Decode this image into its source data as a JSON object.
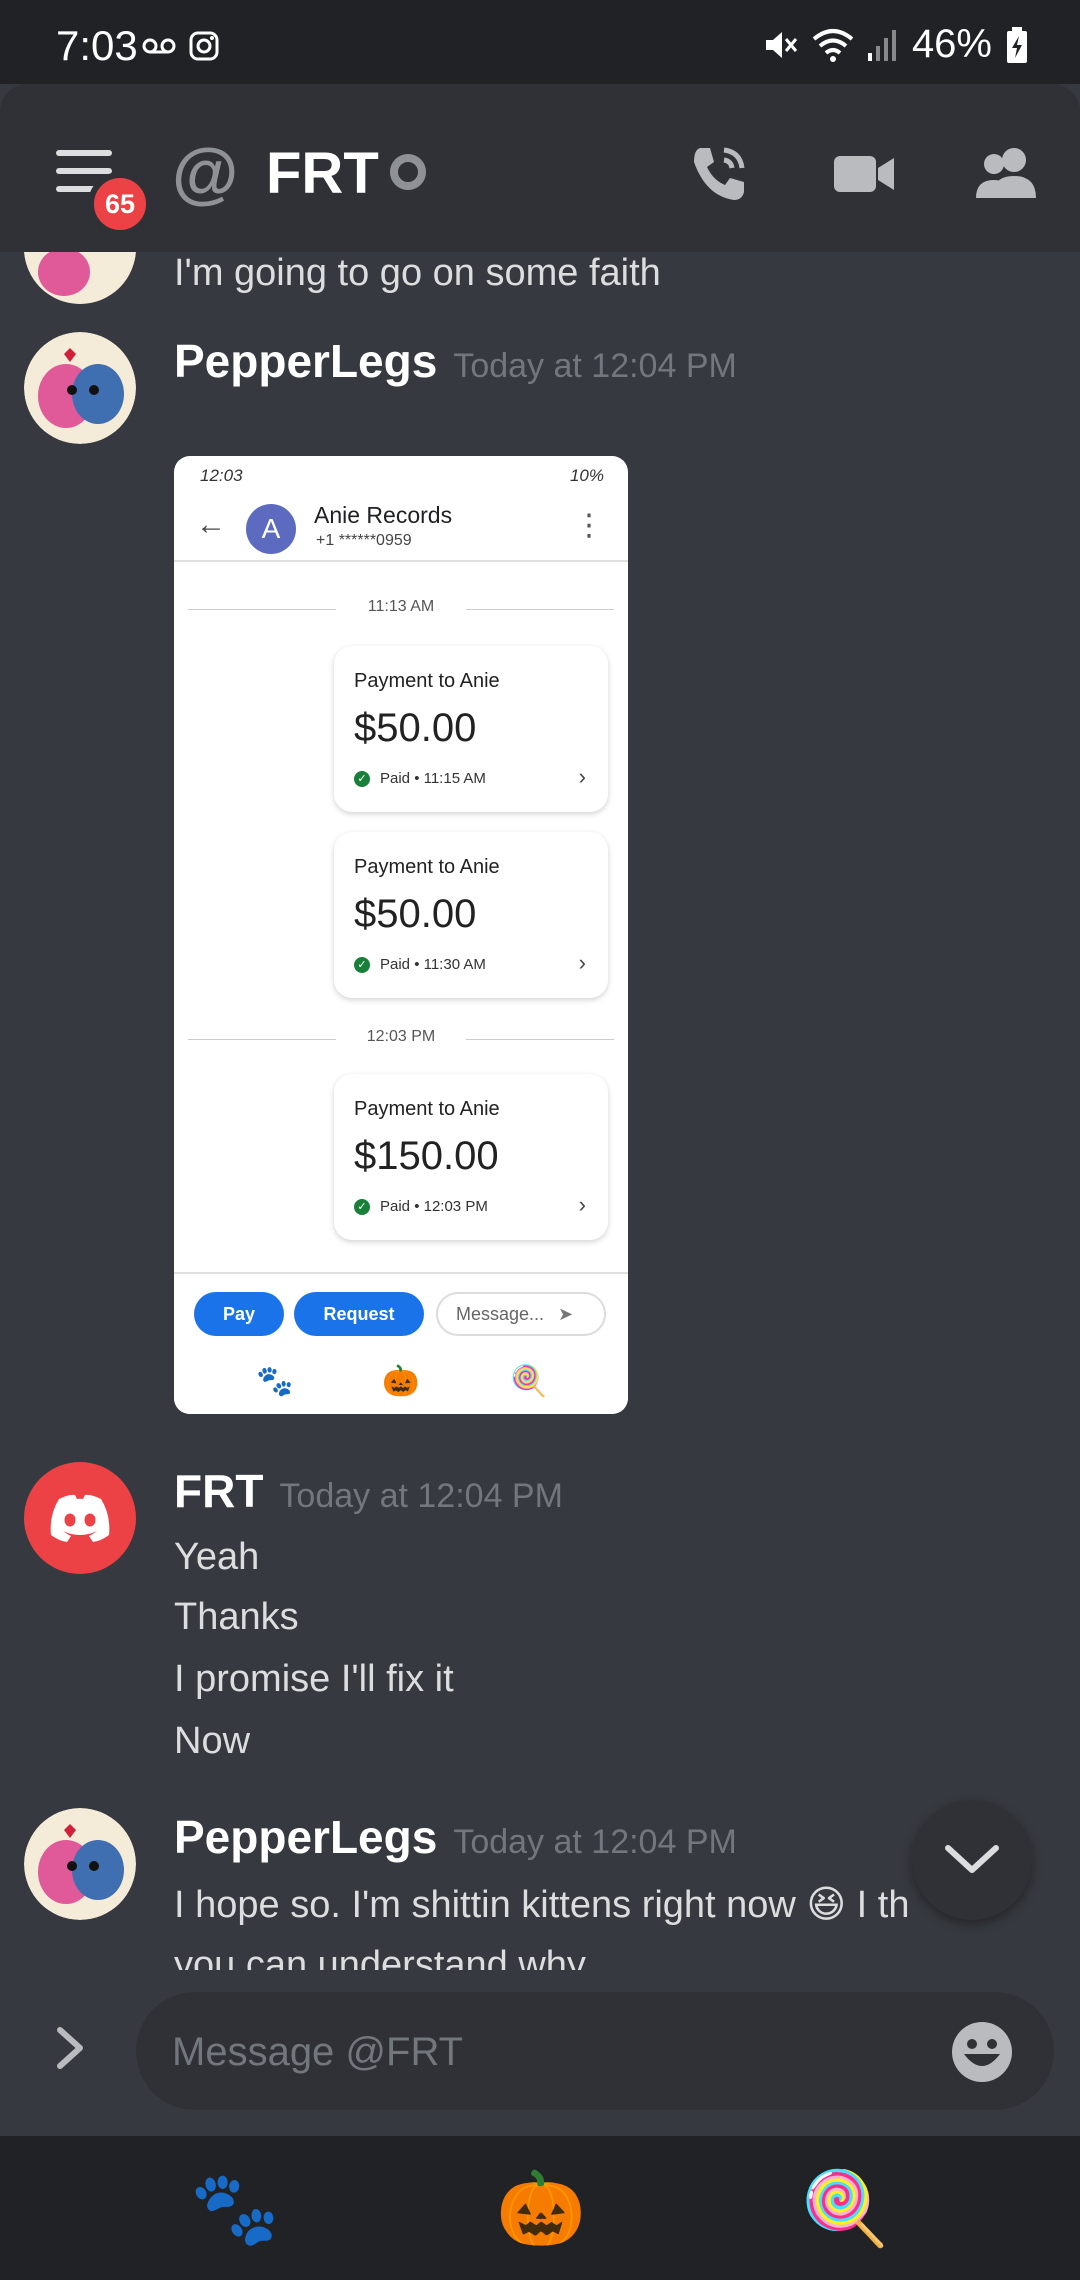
{
  "status_bar": {
    "time": "7:03",
    "battery": "46%"
  },
  "header": {
    "badge": "65",
    "channel_prefix": "@",
    "channel_name": "FRT"
  },
  "messages": {
    "top_fragment": "I'm going to go on some faith",
    "pepper1": {
      "author": "PepperLegs",
      "timestamp": "Today at 12:04 PM"
    },
    "frt": {
      "author": "FRT",
      "timestamp": "Today at 12:04 PM",
      "lines": [
        "Yeah",
        "Thanks",
        "I promise I'll fix it",
        "Now"
      ]
    },
    "pepper2": {
      "author": "PepperLegs",
      "timestamp": "Today at 12:04 PM",
      "line1": "I hope so. I'm shittin kittens right now",
      "line1_emoji": "😆",
      "line1_tail": "I th",
      "line2": "you can understand why"
    }
  },
  "attachment": {
    "status_time": "12:03",
    "status_battery": "10%",
    "contact_initial": "A",
    "contact_name": "Anie Records",
    "contact_number": "+1 ******0959",
    "separators": [
      "11:13 AM",
      "12:03 PM"
    ],
    "payments": [
      {
        "title": "Payment to Anie",
        "amount": "$50.00",
        "status": "Paid • 11:15 AM"
      },
      {
        "title": "Payment to Anie",
        "amount": "$50.00",
        "status": "Paid • 11:30 AM"
      },
      {
        "title": "Payment to Anie",
        "amount": "$150.00",
        "status": "Paid • 12:03 PM"
      }
    ],
    "pay_label": "Pay",
    "request_label": "Request",
    "message_placeholder": "Message...",
    "emojis": [
      "🐾",
      "🎃",
      "🍭"
    ]
  },
  "composer": {
    "placeholder": "Message @FRT"
  },
  "bottom_nav": {
    "items": [
      "🐾",
      "🎃",
      "🍭"
    ]
  },
  "colors": {
    "background": "#36393f",
    "header": "#2f3136",
    "badge": "#ed4245",
    "discord_brand": "#ed4245",
    "gpay_blue": "#1a73e8"
  }
}
